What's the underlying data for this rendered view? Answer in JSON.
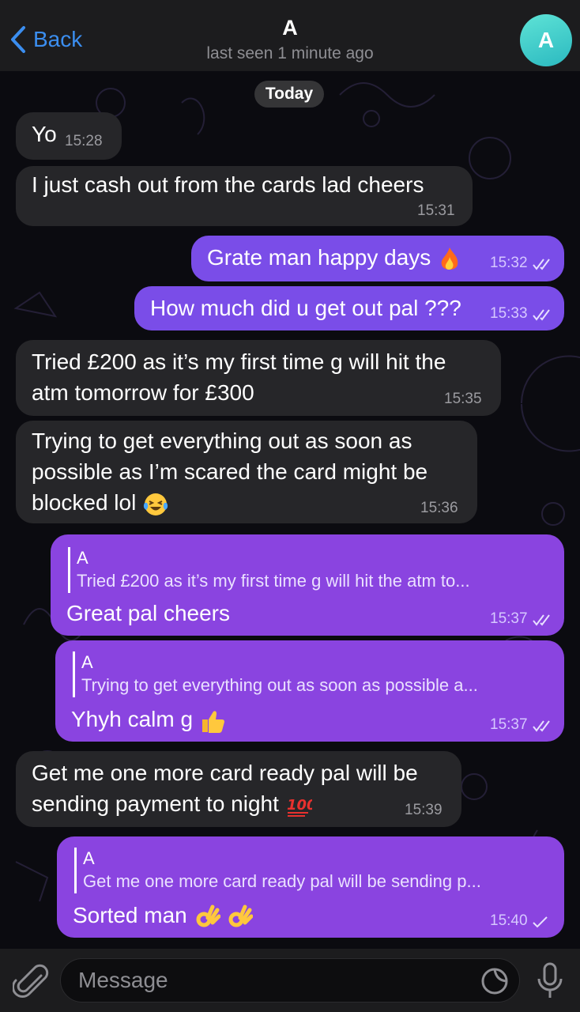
{
  "header": {
    "back_label": "Back",
    "contact_name": "A",
    "status": "last seen 1 minute ago",
    "avatar_letter": "A"
  },
  "date_separator": "Today",
  "messages": [
    {
      "direction": "in",
      "text_lines": [
        "Yo"
      ],
      "time": "15:28"
    },
    {
      "direction": "in",
      "text_lines": [
        "I just cash out from the cards lad cheers"
      ],
      "time": "15:31"
    },
    {
      "direction": "out",
      "text_lines": [
        "Grate man happy days"
      ],
      "emoji": "fire",
      "time": "15:32",
      "status": "read"
    },
    {
      "direction": "out",
      "text_lines": [
        "How much did u get out pal ???"
      ],
      "time": "15:33",
      "status": "read"
    },
    {
      "direction": "in",
      "text_lines": [
        "Tried £200 as it’s my first time g will hit the",
        "atm tomorrow for £300"
      ],
      "time": "15:35"
    },
    {
      "direction": "in",
      "text_lines": [
        "Trying to get everything out as soon as",
        "possible as I’m scared the card might be",
        "blocked lol"
      ],
      "emoji": "laughing-crying",
      "time": "15:36"
    },
    {
      "direction": "out",
      "reply_to": {
        "name": "A",
        "text": "Tried £200 as it’s my first time g will hit the atm to..."
      },
      "text_lines": [
        "Great pal cheers"
      ],
      "time": "15:37",
      "status": "read"
    },
    {
      "direction": "out",
      "reply_to": {
        "name": "A",
        "text": "Trying to get everything out as soon as possible a..."
      },
      "text_lines": [
        "Yhyh calm g"
      ],
      "emoji": "thumbs-up",
      "time": "15:37",
      "status": "read"
    },
    {
      "direction": "in",
      "text_lines": [
        "Get me one more card ready pal will be",
        "sending payment to night"
      ],
      "emoji": "hundred-points",
      "time": "15:39"
    },
    {
      "direction": "out",
      "reply_to": {
        "name": "A",
        "text": "Get me one more card ready pal will be sending p..."
      },
      "text_lines": [
        "Sorted man"
      ],
      "emoji": "ok-hand ok-hand",
      "time": "15:40",
      "status": "sent"
    }
  ],
  "composer": {
    "placeholder": "Message",
    "icons": [
      "paperclip-icon",
      "sticker-icon",
      "microphone-icon"
    ]
  },
  "colors": {
    "incoming_bubble": "#262629",
    "outgoing_bubble": "#7a4de8",
    "outgoing_bubble_reply": "#8a44e0",
    "accent": "#3b8ef0",
    "avatar": "#2bb9c0"
  }
}
